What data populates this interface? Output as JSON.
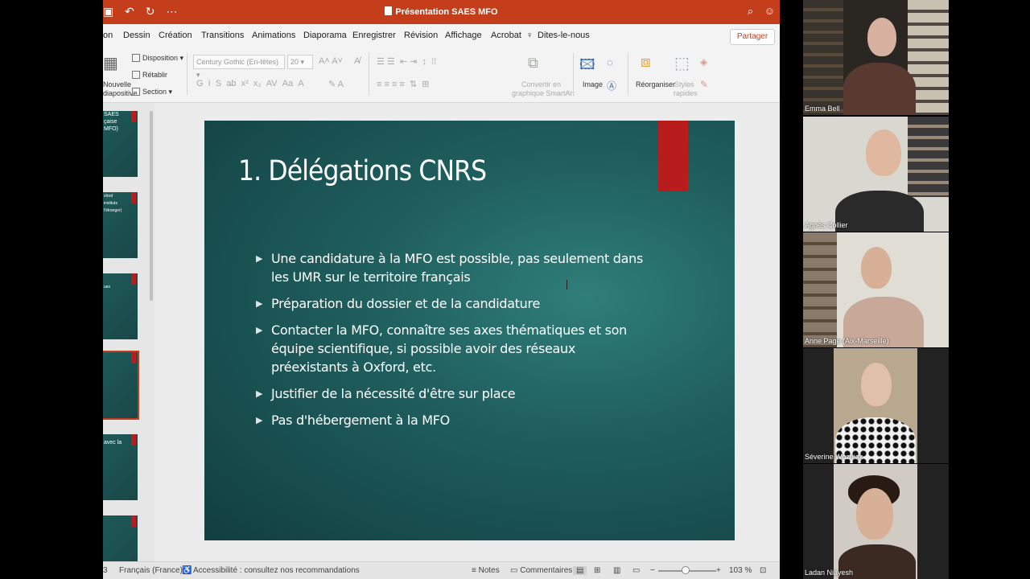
{
  "window": {
    "title": "Présentation SAES MFO"
  },
  "menu": {
    "tabs": [
      "on",
      "Dessin",
      "Création",
      "Transitions",
      "Animations",
      "Diaporama",
      "Enregistrer",
      "Révision",
      "Affichage",
      "Acrobat",
      "Dites-le-nous"
    ],
    "share_label": "Partager"
  },
  "ribbon": {
    "new_slide_label_1": "Nouvelle",
    "new_slide_label_2": "diapositive",
    "disposition_label": "Disposition",
    "retablir_label": "Rétablir",
    "section_label": "Section",
    "font_name": "Century Gothic (En-têtes)",
    "font_size": "20",
    "smartart_label_1": "Convertir en",
    "smartart_label_2": "graphique SmartArt",
    "image_label": "Image",
    "reorganiser_label": "Réorganiser",
    "styles_label_1": "Styles",
    "styles_label_2": "rapides"
  },
  "thumbnails": [
    {
      "text": "SAES\nçaise\nMFO)",
      "active": false
    },
    {
      "text": "xford\ninstituts\nl'étranger)",
      "active": false
    },
    {
      "text": "ues",
      "active": false
    },
    {
      "text": "",
      "active": true
    },
    {
      "text": "avec la",
      "active": false
    },
    {
      "text": "",
      "active": false
    }
  ],
  "slide": {
    "title": "1. Délégations CNRS",
    "bullets": [
      "Une candidature à la MFO est possible, pas seulement dans les UMR sur le territoire français",
      "Préparation du dossier et de la candidature",
      "Contacter la MFO, connaître ses axes thématiques et son équipe scientifique, si possible avoir des réseaux préexistants à Oxford, etc.",
      "Justifier de la nécessité d'être sur place",
      "Pas d'hébergement à la MFO"
    ]
  },
  "status": {
    "slide_num": "3",
    "language": "Français (France)",
    "accessibility": "Accessibilité : consultez nos recommandations",
    "notes_label": "Notes",
    "comments_label": "Commentaires",
    "zoom": "103 %"
  },
  "participants": [
    {
      "name": "Emma Bell"
    },
    {
      "name": "Agnès Collier"
    },
    {
      "name": "Anne Page (Aix-Marseille)"
    },
    {
      "name": "Séverine Wozniak"
    },
    {
      "name": "Ladan Niayesh"
    }
  ],
  "colors": {
    "ppt_red": "#c43e1c",
    "slide_bg": "#1f5f5e",
    "slide_accent": "#b81c1c"
  }
}
